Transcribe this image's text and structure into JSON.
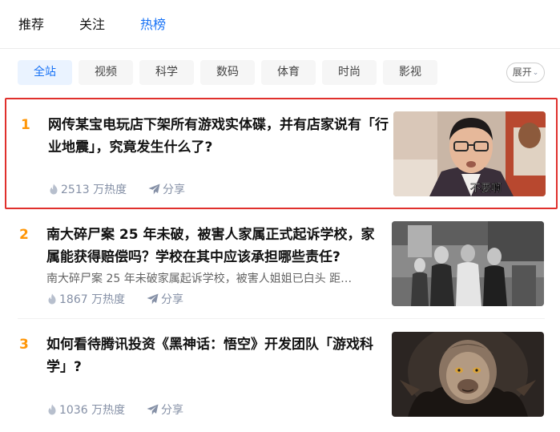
{
  "top_tabs": [
    {
      "label": "推荐",
      "active": false
    },
    {
      "label": "关注",
      "active": false
    },
    {
      "label": "热榜",
      "active": true
    }
  ],
  "categories": [
    {
      "label": "全站",
      "active": true
    },
    {
      "label": "视频",
      "active": false
    },
    {
      "label": "科学",
      "active": false
    },
    {
      "label": "数码",
      "active": false
    },
    {
      "label": "体育",
      "active": false
    },
    {
      "label": "时尚",
      "active": false
    },
    {
      "label": "影视",
      "active": false
    }
  ],
  "expand_label": "展开",
  "colors": {
    "accent": "#1772f6",
    "rank": "#ff9607",
    "highlight_border": "#e0302c",
    "meta": "#8590a6"
  },
  "hot_list": [
    {
      "rank": "1",
      "title": "网传某宝电玩店下架所有游戏实体碟，并有店家说有「行业地震」，究竟发生什么了?",
      "excerpt": "",
      "heat": "2513 万热度",
      "share": "分享",
      "image_caption": "不要啊",
      "highlighted": true
    },
    {
      "rank": "2",
      "title": "南大碎尸案 25 年未破，被害人家属正式起诉学校，家属能获得赔偿吗？学校在其中应该承担哪些责任?",
      "excerpt": "南大碎尸案 25 年未破家属起诉学校，被害人姐姐已白头 距…",
      "heat": "1867 万热度",
      "share": "分享",
      "highlighted": false
    },
    {
      "rank": "3",
      "title": "如何看待腾讯投资《黑神话：悟空》开发团队「游戏科学」?",
      "excerpt": "",
      "heat": "1036 万热度",
      "share": "分享",
      "highlighted": false
    }
  ]
}
